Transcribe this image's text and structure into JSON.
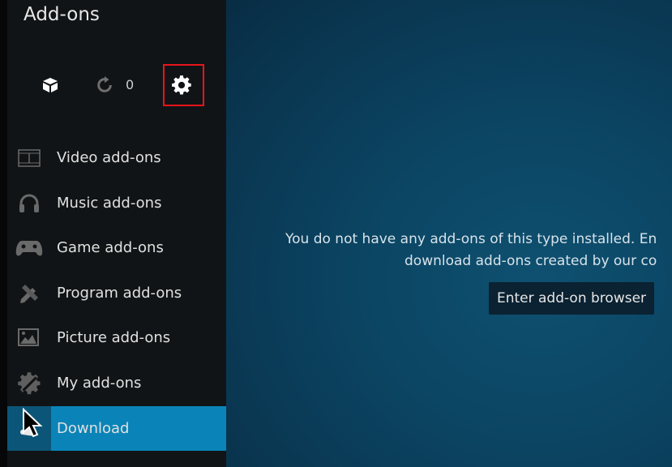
{
  "header": {
    "title": "Add-ons"
  },
  "toolbar": {
    "install_icon": "open-box-icon",
    "updates_icon": "refresh-icon",
    "updates_count": "0",
    "settings_icon": "gear-icon",
    "highlight_color": "#e8141a"
  },
  "sidebar": {
    "items": [
      {
        "label": "Video add-ons",
        "icon": "film-icon"
      },
      {
        "label": "Music add-ons",
        "icon": "headphones-icon"
      },
      {
        "label": "Game add-ons",
        "icon": "gamepad-icon"
      },
      {
        "label": "Program add-ons",
        "icon": "tools-icon"
      },
      {
        "label": "Picture add-ons",
        "icon": "picture-icon"
      },
      {
        "label": "My add-ons",
        "icon": "gear-wrench-icon"
      },
      {
        "label": "Download",
        "icon": "download-icon",
        "active": true
      }
    ],
    "active_color": "#0a84b8"
  },
  "main": {
    "message_line1": "You do not have any add-ons of this type installed. En",
    "message_line2": "download add-ons created by our co",
    "browser_button": "Enter add-on browser"
  }
}
